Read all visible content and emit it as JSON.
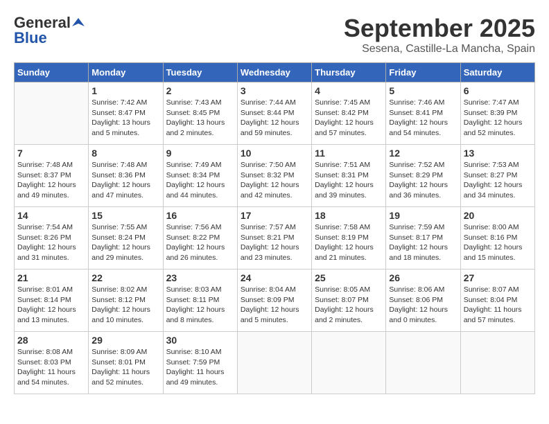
{
  "logo": {
    "general": "General",
    "blue": "Blue"
  },
  "title": "September 2025",
  "location": "Sesena, Castille-La Mancha, Spain",
  "weekdays": [
    "Sunday",
    "Monday",
    "Tuesday",
    "Wednesday",
    "Thursday",
    "Friday",
    "Saturday"
  ],
  "weeks": [
    [
      {
        "day": "",
        "info": ""
      },
      {
        "day": "1",
        "info": "Sunrise: 7:42 AM\nSunset: 8:47 PM\nDaylight: 13 hours\nand 5 minutes."
      },
      {
        "day": "2",
        "info": "Sunrise: 7:43 AM\nSunset: 8:45 PM\nDaylight: 13 hours\nand 2 minutes."
      },
      {
        "day": "3",
        "info": "Sunrise: 7:44 AM\nSunset: 8:44 PM\nDaylight: 12 hours\nand 59 minutes."
      },
      {
        "day": "4",
        "info": "Sunrise: 7:45 AM\nSunset: 8:42 PM\nDaylight: 12 hours\nand 57 minutes."
      },
      {
        "day": "5",
        "info": "Sunrise: 7:46 AM\nSunset: 8:41 PM\nDaylight: 12 hours\nand 54 minutes."
      },
      {
        "day": "6",
        "info": "Sunrise: 7:47 AM\nSunset: 8:39 PM\nDaylight: 12 hours\nand 52 minutes."
      }
    ],
    [
      {
        "day": "7",
        "info": "Sunrise: 7:48 AM\nSunset: 8:37 PM\nDaylight: 12 hours\nand 49 minutes."
      },
      {
        "day": "8",
        "info": "Sunrise: 7:48 AM\nSunset: 8:36 PM\nDaylight: 12 hours\nand 47 minutes."
      },
      {
        "day": "9",
        "info": "Sunrise: 7:49 AM\nSunset: 8:34 PM\nDaylight: 12 hours\nand 44 minutes."
      },
      {
        "day": "10",
        "info": "Sunrise: 7:50 AM\nSunset: 8:32 PM\nDaylight: 12 hours\nand 42 minutes."
      },
      {
        "day": "11",
        "info": "Sunrise: 7:51 AM\nSunset: 8:31 PM\nDaylight: 12 hours\nand 39 minutes."
      },
      {
        "day": "12",
        "info": "Sunrise: 7:52 AM\nSunset: 8:29 PM\nDaylight: 12 hours\nand 36 minutes."
      },
      {
        "day": "13",
        "info": "Sunrise: 7:53 AM\nSunset: 8:27 PM\nDaylight: 12 hours\nand 34 minutes."
      }
    ],
    [
      {
        "day": "14",
        "info": "Sunrise: 7:54 AM\nSunset: 8:26 PM\nDaylight: 12 hours\nand 31 minutes."
      },
      {
        "day": "15",
        "info": "Sunrise: 7:55 AM\nSunset: 8:24 PM\nDaylight: 12 hours\nand 29 minutes."
      },
      {
        "day": "16",
        "info": "Sunrise: 7:56 AM\nSunset: 8:22 PM\nDaylight: 12 hours\nand 26 minutes."
      },
      {
        "day": "17",
        "info": "Sunrise: 7:57 AM\nSunset: 8:21 PM\nDaylight: 12 hours\nand 23 minutes."
      },
      {
        "day": "18",
        "info": "Sunrise: 7:58 AM\nSunset: 8:19 PM\nDaylight: 12 hours\nand 21 minutes."
      },
      {
        "day": "19",
        "info": "Sunrise: 7:59 AM\nSunset: 8:17 PM\nDaylight: 12 hours\nand 18 minutes."
      },
      {
        "day": "20",
        "info": "Sunrise: 8:00 AM\nSunset: 8:16 PM\nDaylight: 12 hours\nand 15 minutes."
      }
    ],
    [
      {
        "day": "21",
        "info": "Sunrise: 8:01 AM\nSunset: 8:14 PM\nDaylight: 12 hours\nand 13 minutes."
      },
      {
        "day": "22",
        "info": "Sunrise: 8:02 AM\nSunset: 8:12 PM\nDaylight: 12 hours\nand 10 minutes."
      },
      {
        "day": "23",
        "info": "Sunrise: 8:03 AM\nSunset: 8:11 PM\nDaylight: 12 hours\nand 8 minutes."
      },
      {
        "day": "24",
        "info": "Sunrise: 8:04 AM\nSunset: 8:09 PM\nDaylight: 12 hours\nand 5 minutes."
      },
      {
        "day": "25",
        "info": "Sunrise: 8:05 AM\nSunset: 8:07 PM\nDaylight: 12 hours\nand 2 minutes."
      },
      {
        "day": "26",
        "info": "Sunrise: 8:06 AM\nSunset: 8:06 PM\nDaylight: 12 hours\nand 0 minutes."
      },
      {
        "day": "27",
        "info": "Sunrise: 8:07 AM\nSunset: 8:04 PM\nDaylight: 11 hours\nand 57 minutes."
      }
    ],
    [
      {
        "day": "28",
        "info": "Sunrise: 8:08 AM\nSunset: 8:03 PM\nDaylight: 11 hours\nand 54 minutes."
      },
      {
        "day": "29",
        "info": "Sunrise: 8:09 AM\nSunset: 8:01 PM\nDaylight: 11 hours\nand 52 minutes."
      },
      {
        "day": "30",
        "info": "Sunrise: 8:10 AM\nSunset: 7:59 PM\nDaylight: 11 hours\nand 49 minutes."
      },
      {
        "day": "",
        "info": ""
      },
      {
        "day": "",
        "info": ""
      },
      {
        "day": "",
        "info": ""
      },
      {
        "day": "",
        "info": ""
      }
    ]
  ]
}
